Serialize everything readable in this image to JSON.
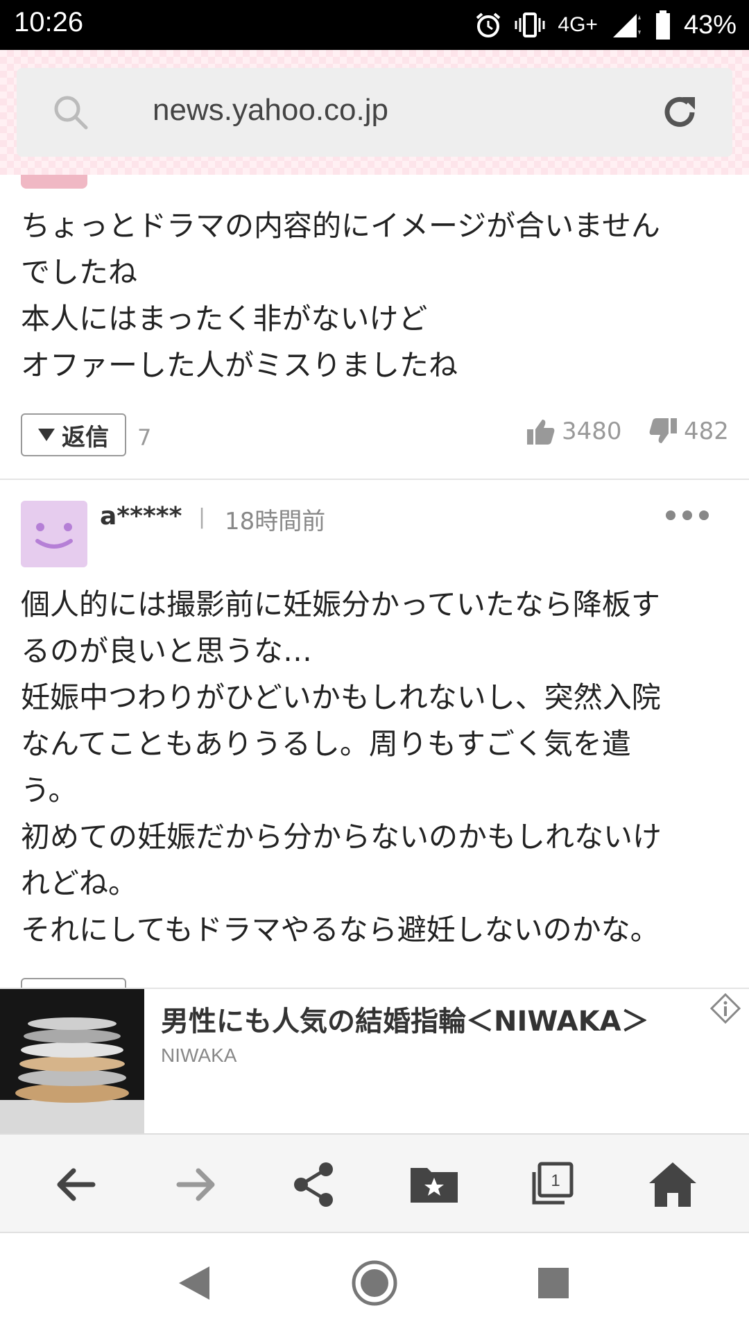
{
  "status_bar": {
    "time": "10:26",
    "network": "4G+",
    "battery": "43%"
  },
  "browser": {
    "url": "news.yahoo.co.jp",
    "tab_count": "1"
  },
  "comments": [
    {
      "text": "ちょっとドラマの内容的にイメージが合いません\nでしたね\n本人にはまったく非がないけど\nオファーした人がミスりましたね",
      "reply_label": "返信",
      "reply_count": "7",
      "likes": "3480",
      "dislikes": "482"
    },
    {
      "user": "a*****",
      "separator": "|",
      "time_ago": "18時間前",
      "text": "個人的には撮影前に妊娠分かっていたなら降板す\nるのが良いと思うな…\n妊娠中つわりがひどいかもしれないし、突然入院\nなんてこともありうるし。周りもすごく気を遣\nう。\n初めての妊娠だから分からないのかもしれないけ\nれどね。\nそれにしてもドラマやるなら避妊しないのかな。"
    }
  ],
  "ad": {
    "title": "男性にも人気の結婚指輪＜NIWAKA＞",
    "sponsor": "NIWAKA"
  },
  "colors": {
    "accent_pink": "#f0b8c4",
    "avatar_bg": "#e6ccee",
    "avatar_face": "#b57fd6"
  }
}
